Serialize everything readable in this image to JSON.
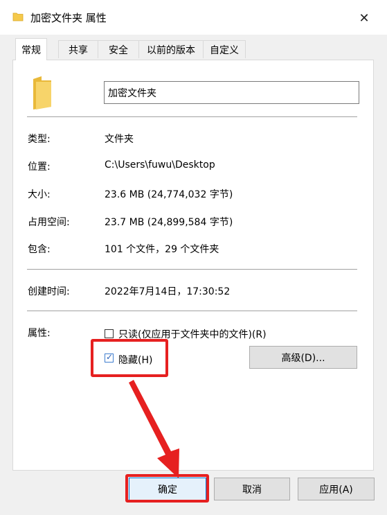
{
  "window": {
    "title": "加密文件夹 属性",
    "close_label": "✕"
  },
  "tabs": [
    {
      "label": "常规",
      "active": true
    },
    {
      "label": "共享"
    },
    {
      "label": "安全"
    },
    {
      "label": "以前的版本"
    },
    {
      "label": "自定义"
    }
  ],
  "general": {
    "folder_name": "加密文件夹",
    "type_label": "类型:",
    "type_value": "文件夹",
    "location_label": "位置:",
    "location_value": "C:\\Users\\fuwu\\Desktop",
    "size_label": "大小:",
    "size_value": "23.6 MB (24,774,032 字节)",
    "disk_size_label": "占用空间:",
    "disk_size_value": "23.7 MB (24,899,584 字节)",
    "contains_label": "包含:",
    "contains_value": "101 个文件，29 个文件夹",
    "created_label": "创建时间:",
    "created_value": "2022年7月14日，17:30:52",
    "attributes_label": "属性:",
    "readonly_label": "只读(仅应用于文件夹中的文件)(R)",
    "readonly_checked": false,
    "hidden_label": "隐藏(H)",
    "hidden_checked": true,
    "advanced_label": "高级(D)..."
  },
  "buttons": {
    "ok": "确定",
    "cancel": "取消",
    "apply": "应用(A)"
  },
  "colors": {
    "highlight": "#e62020",
    "folder": "#f5c94b",
    "checkbox": "#2a62b8"
  }
}
